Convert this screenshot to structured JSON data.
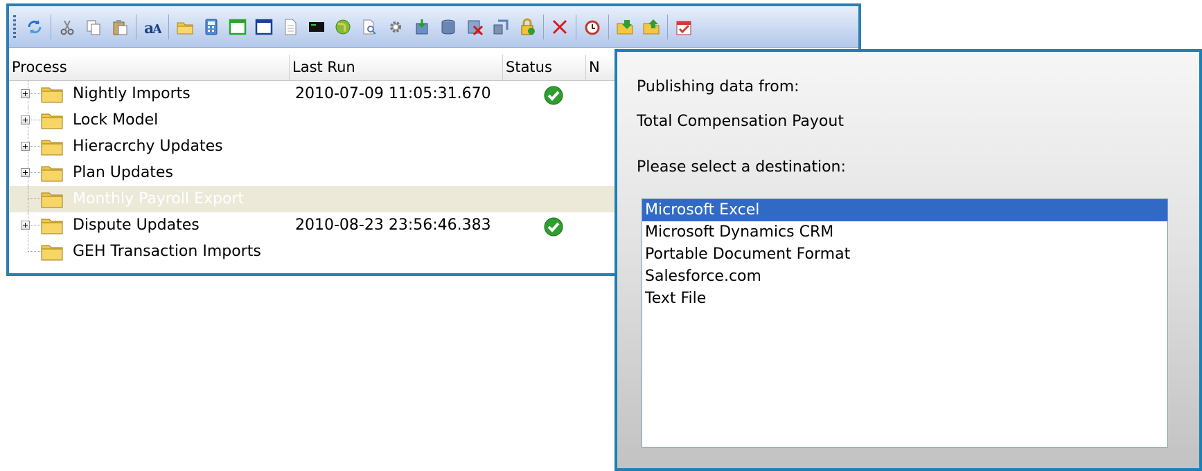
{
  "toolbar": {
    "buttons": [
      {
        "icon": "refresh-icon"
      },
      {
        "sep": true
      },
      {
        "icon": "cut-icon"
      },
      {
        "icon": "copy-icon"
      },
      {
        "icon": "paste-icon"
      },
      {
        "sep": true
      },
      {
        "icon": "rename-icon"
      },
      {
        "sep": true
      },
      {
        "icon": "folder-icon"
      },
      {
        "icon": "calculator-icon"
      },
      {
        "icon": "green-window-icon"
      },
      {
        "icon": "blue-window-icon"
      },
      {
        "icon": "document-icon"
      },
      {
        "icon": "terminal-icon"
      },
      {
        "icon": "globe-icon"
      },
      {
        "icon": "search-doc-icon"
      },
      {
        "icon": "gear-icon"
      },
      {
        "icon": "import-icon"
      },
      {
        "icon": "database-icon"
      },
      {
        "icon": "delete-data-icon"
      },
      {
        "icon": "transfer-icon"
      },
      {
        "icon": "lock-icon"
      },
      {
        "sep": true
      },
      {
        "icon": "close-icon"
      },
      {
        "sep": true
      },
      {
        "icon": "alarm-clock-icon"
      },
      {
        "sep": true
      },
      {
        "icon": "open-folder-icon"
      },
      {
        "icon": "upload-folder-icon"
      },
      {
        "sep": true
      },
      {
        "icon": "checklist-icon"
      }
    ]
  },
  "columns": {
    "process": "Process",
    "last_run": "Last Run",
    "status": "Status",
    "next": "N"
  },
  "processes": [
    {
      "name": "Nightly Imports",
      "last_run": "2010-07-09 11:05:31.670",
      "expandable": true,
      "status": "success",
      "selected": false
    },
    {
      "name": "Lock Model",
      "last_run": "",
      "expandable": true,
      "status": "",
      "selected": false
    },
    {
      "name": "Hieracrchy Updates",
      "last_run": "",
      "expandable": true,
      "status": "",
      "selected": false
    },
    {
      "name": "Plan Updates",
      "last_run": "",
      "expandable": true,
      "status": "",
      "selected": false
    },
    {
      "name": "Monthly Payroll Export",
      "last_run": "",
      "expandable": false,
      "status": "",
      "selected": true
    },
    {
      "name": "Dispute Updates",
      "last_run": "2010-08-23 23:56:46.383",
      "expandable": true,
      "status": "success",
      "selected": false
    },
    {
      "name": "GEH Transaction Imports",
      "last_run": "",
      "expandable": false,
      "status": "",
      "selected": false
    }
  ],
  "dialog": {
    "publishing_label": "Publishing data from:",
    "source_name": "Total Compensation Payout",
    "destination_label": "Please select a destination:",
    "destinations": [
      "Microsoft Excel",
      "Microsoft Dynamics CRM",
      "Portable Document Format",
      "Salesforce.com",
      "Text File"
    ],
    "selected_destination": "Microsoft Excel"
  },
  "colors": {
    "window_border": "#2e7fb1",
    "selection": "#316ac5",
    "selected_row": "#ece9d8",
    "folder": "#f2c744",
    "status_ok": "#2e9e2e"
  }
}
